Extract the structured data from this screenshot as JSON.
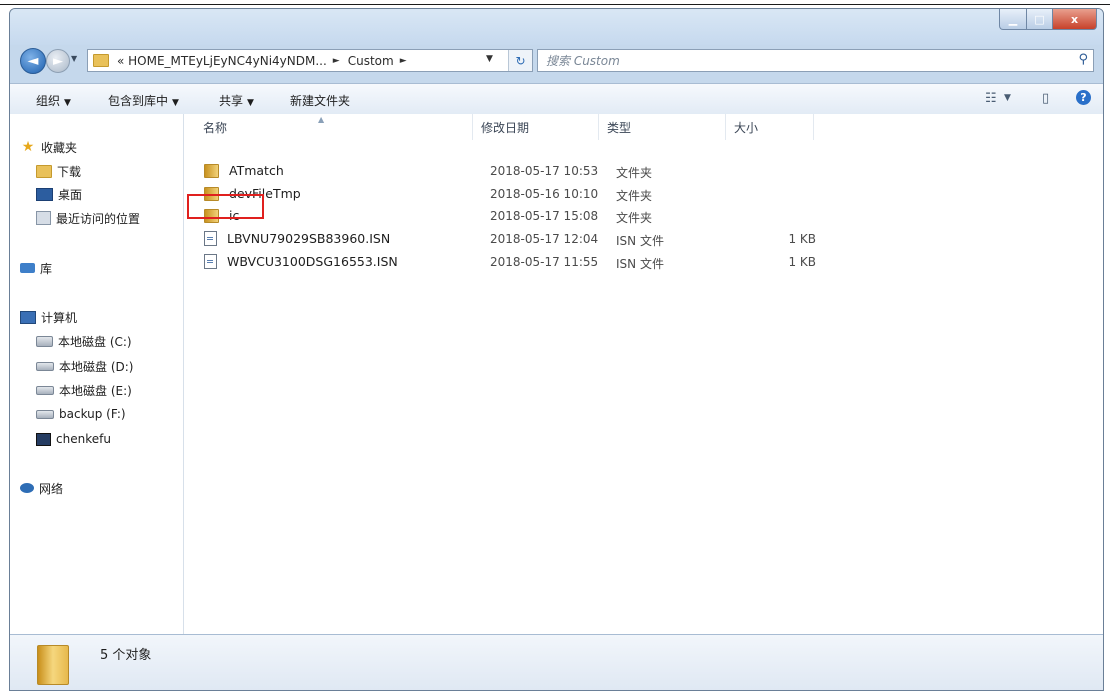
{
  "window": {
    "controls": {
      "minimize": "▁",
      "maximize": "□",
      "close": "x"
    }
  },
  "navigation": {
    "back": "◄",
    "forward": "►",
    "recent": "▼",
    "address": {
      "crumb1": "« HOME_MTEyLjEyNC4yNi4yNDM...",
      "sep1": "►",
      "crumb2": "Custom",
      "sep2": "►",
      "dropdown": "▼",
      "refresh": "↻"
    },
    "search": {
      "placeholder": "搜索 Custom",
      "icon": "⚲"
    }
  },
  "toolbar": {
    "organize": "组织",
    "include": "包含到库中",
    "share": "共享",
    "new_folder": "新建文件夹",
    "dd": "▼",
    "view_icon": "☷",
    "pane_icon": "▯",
    "help": "?"
  },
  "sidebar": {
    "favorites": "收藏夹",
    "downloads": "下载",
    "desktop": "桌面",
    "recent_places": "最近访问的位置",
    "libraries": "库",
    "computer": "计算机",
    "drive_c": "本地磁盘 (C:)",
    "drive_d": "本地磁盘 (D:)",
    "drive_e": "本地磁盘 (E:)",
    "drive_f": "backup (F:)",
    "chenkefu": "chenkefu",
    "network": "网络"
  },
  "columns": {
    "name": "名称",
    "date": "修改日期",
    "type": "类型",
    "size": "大小",
    "sort": "▲"
  },
  "files": [
    {
      "name": "ATmatch",
      "date": "2018-05-17 10:53",
      "type": "文件夹",
      "size": ""
    },
    {
      "name": "devFileTmp",
      "date": "2018-05-16 10:10",
      "type": "文件夹",
      "size": ""
    },
    {
      "name": "ic",
      "date": "2018-05-17 15:08",
      "type": "文件夹",
      "size": ""
    },
    {
      "name": "LBVNU79029SB83960.ISN",
      "date": "2018-05-17 12:04",
      "type": "ISN 文件",
      "size": "1 KB"
    },
    {
      "name": "WBVCU3100DSG16553.ISN",
      "date": "2018-05-17 11:55",
      "type": "ISN 文件",
      "size": "1 KB"
    }
  ],
  "status": {
    "count": "5 个对象"
  }
}
